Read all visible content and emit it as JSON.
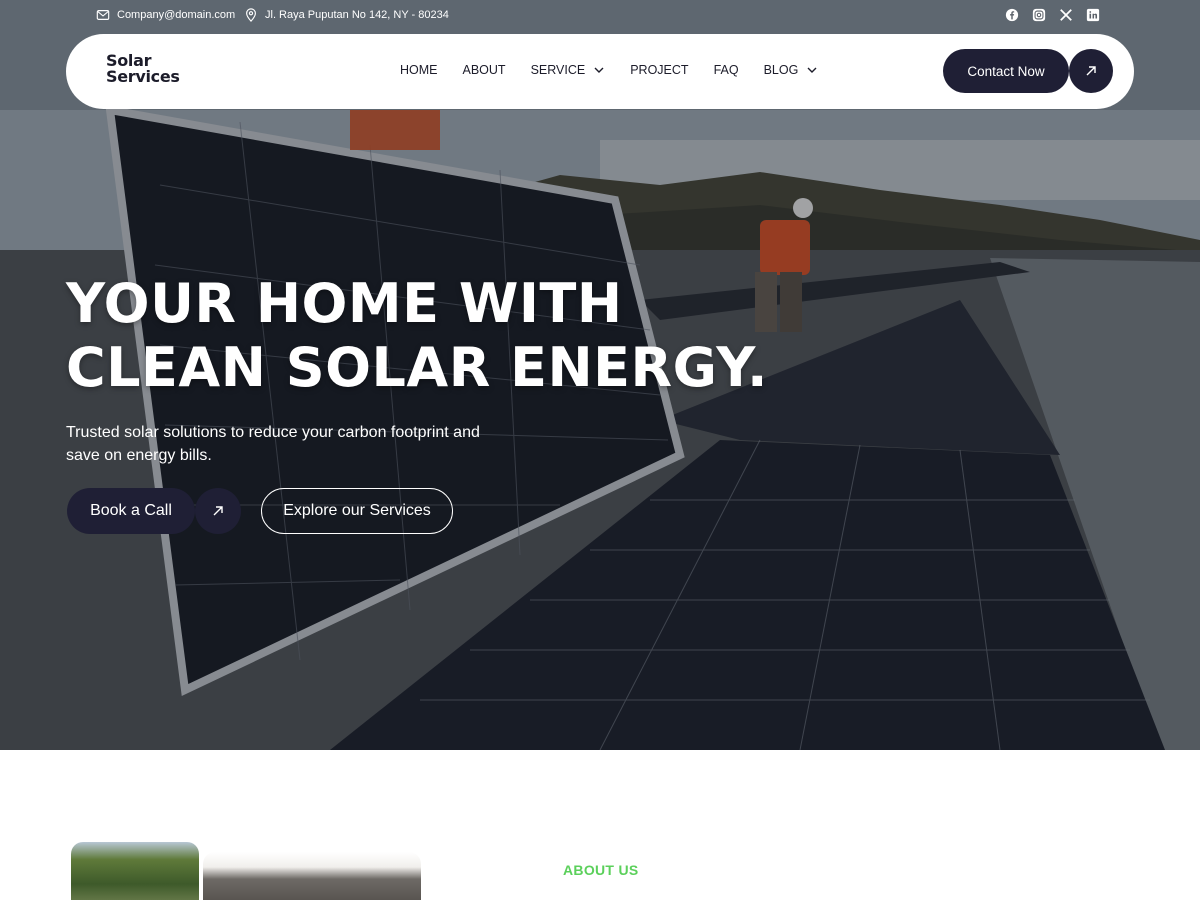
{
  "topbar": {
    "email": "Company@domain.com",
    "address": "Jl. Raya Puputan No 142, NY - 80234",
    "socials": [
      "facebook-icon",
      "instagram-icon",
      "x-icon",
      "linkedin-icon"
    ]
  },
  "brand": {
    "line1": "Solar",
    "line2": "Services"
  },
  "nav": [
    {
      "label": "HOME",
      "dropdown": false
    },
    {
      "label": "ABOUT",
      "dropdown": false
    },
    {
      "label": "SERVICE",
      "dropdown": true
    },
    {
      "label": "PROJECT",
      "dropdown": false
    },
    {
      "label": "FAQ",
      "dropdown": false
    },
    {
      "label": "BLOG",
      "dropdown": true
    }
  ],
  "header": {
    "contact_label": "Contact Now"
  },
  "hero": {
    "headline_line1": "YOUR HOME WITH",
    "headline_line2": "CLEAN SOLAR ENERGY.",
    "subtext": "Trusted solar solutions to reduce your carbon footprint and save on energy bills.",
    "primary_cta": "Book a Call",
    "secondary_cta": "Explore our Services"
  },
  "about": {
    "label": "ABOUT US"
  },
  "colors": {
    "navy": "#1f1f35",
    "accent_green": "#5bd05b",
    "white": "#ffffff"
  }
}
